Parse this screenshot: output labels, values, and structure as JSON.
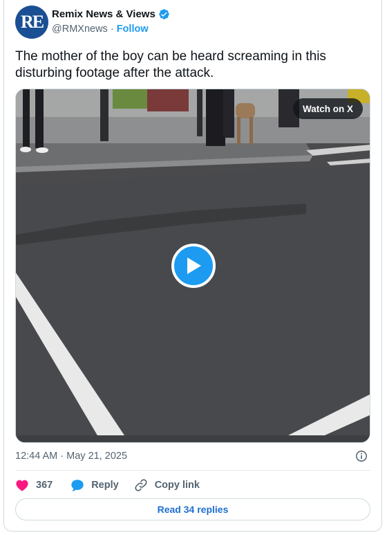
{
  "account": {
    "avatar_text": "RE",
    "name": "Remix News & Views",
    "handle": "@RMXnews",
    "separator": "·",
    "follow_label": "Follow",
    "verified_icon": "verified-badge-icon"
  },
  "tweet": {
    "text": "The mother of the boy can be heard screaming in this disturbing footage after the attack.",
    "timestamp": "12:44 AM · May 21, 2025"
  },
  "media": {
    "watch_label": "Watch on X",
    "play_icon": "play-icon"
  },
  "actions": {
    "like_count": "367",
    "reply_label": "Reply",
    "copy_link_label": "Copy link"
  },
  "footer": {
    "read_replies_label": "Read 34 replies"
  },
  "colors": {
    "accent": "#1d9bf0",
    "like": "#f91880",
    "text": "#0f1419",
    "muted": "#536471",
    "avatar_bg": "#1b4f93"
  }
}
